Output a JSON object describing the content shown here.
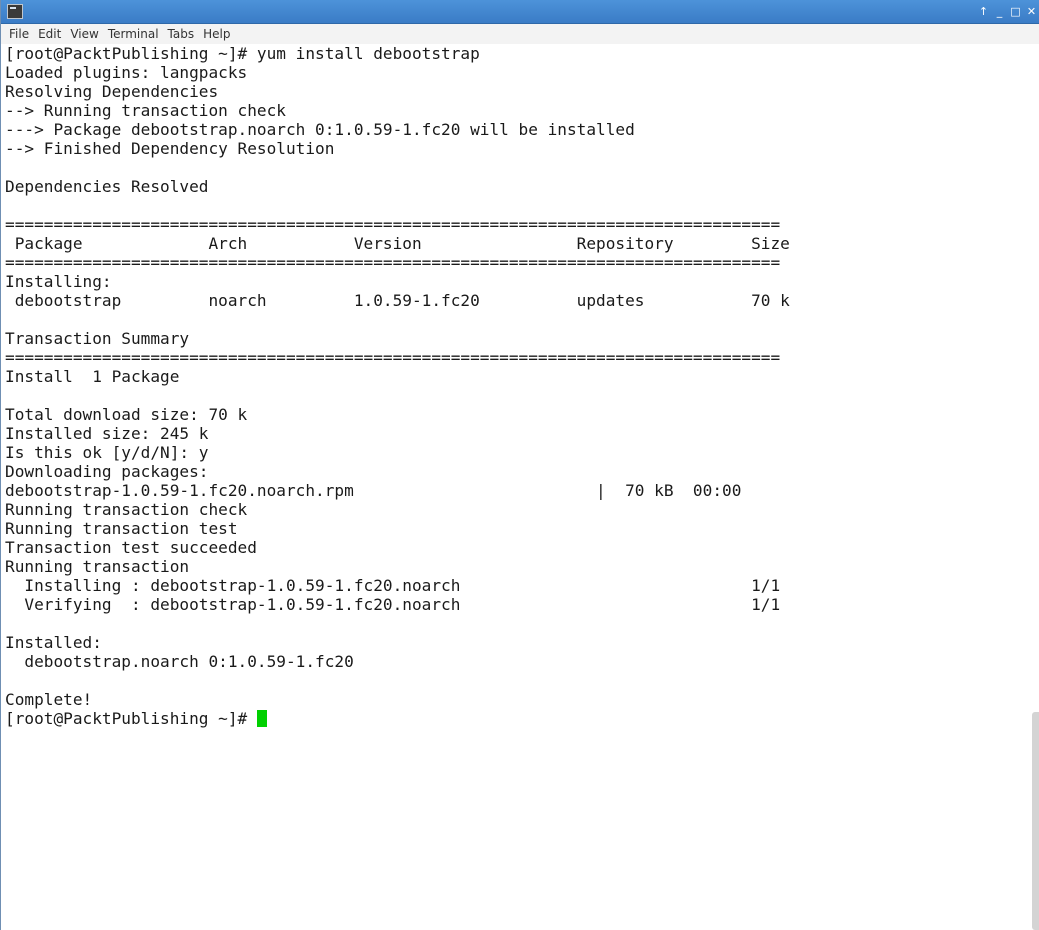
{
  "titlebar": {
    "icon": "terminal-icon",
    "controls": {
      "up": "↑",
      "minimize": "_",
      "maximize": "□",
      "close": "✕"
    }
  },
  "menubar": {
    "items": [
      "File",
      "Edit",
      "View",
      "Terminal",
      "Tabs",
      "Help"
    ]
  },
  "terminal": {
    "lines": [
      "[root@PacktPublishing ~]# yum install debootstrap",
      "Loaded plugins: langpacks",
      "Resolving Dependencies",
      "--> Running transaction check",
      "---> Package debootstrap.noarch 0:1.0.59-1.fc20 will be installed",
      "--> Finished Dependency Resolution",
      "",
      "Dependencies Resolved",
      "",
      "================================================================================",
      " Package             Arch           Version                Repository        Size",
      "================================================================================",
      "Installing:",
      " debootstrap         noarch         1.0.59-1.fc20          updates           70 k",
      "",
      "Transaction Summary",
      "================================================================================",
      "Install  1 Package",
      "",
      "Total download size: 70 k",
      "Installed size: 245 k",
      "Is this ok [y/d/N]: y",
      "Downloading packages:",
      "debootstrap-1.0.59-1.fc20.noarch.rpm                         |  70 kB  00:00",
      "Running transaction check",
      "Running transaction test",
      "Transaction test succeeded",
      "Running transaction",
      "  Installing : debootstrap-1.0.59-1.fc20.noarch                              1/1",
      "  Verifying  : debootstrap-1.0.59-1.fc20.noarch                              1/1",
      "",
      "Installed:",
      "  debootstrap.noarch 0:1.0.59-1.fc20",
      "",
      "Complete!"
    ],
    "prompt": "[root@PacktPublishing ~]# ",
    "cursor_color": "#00d000"
  }
}
